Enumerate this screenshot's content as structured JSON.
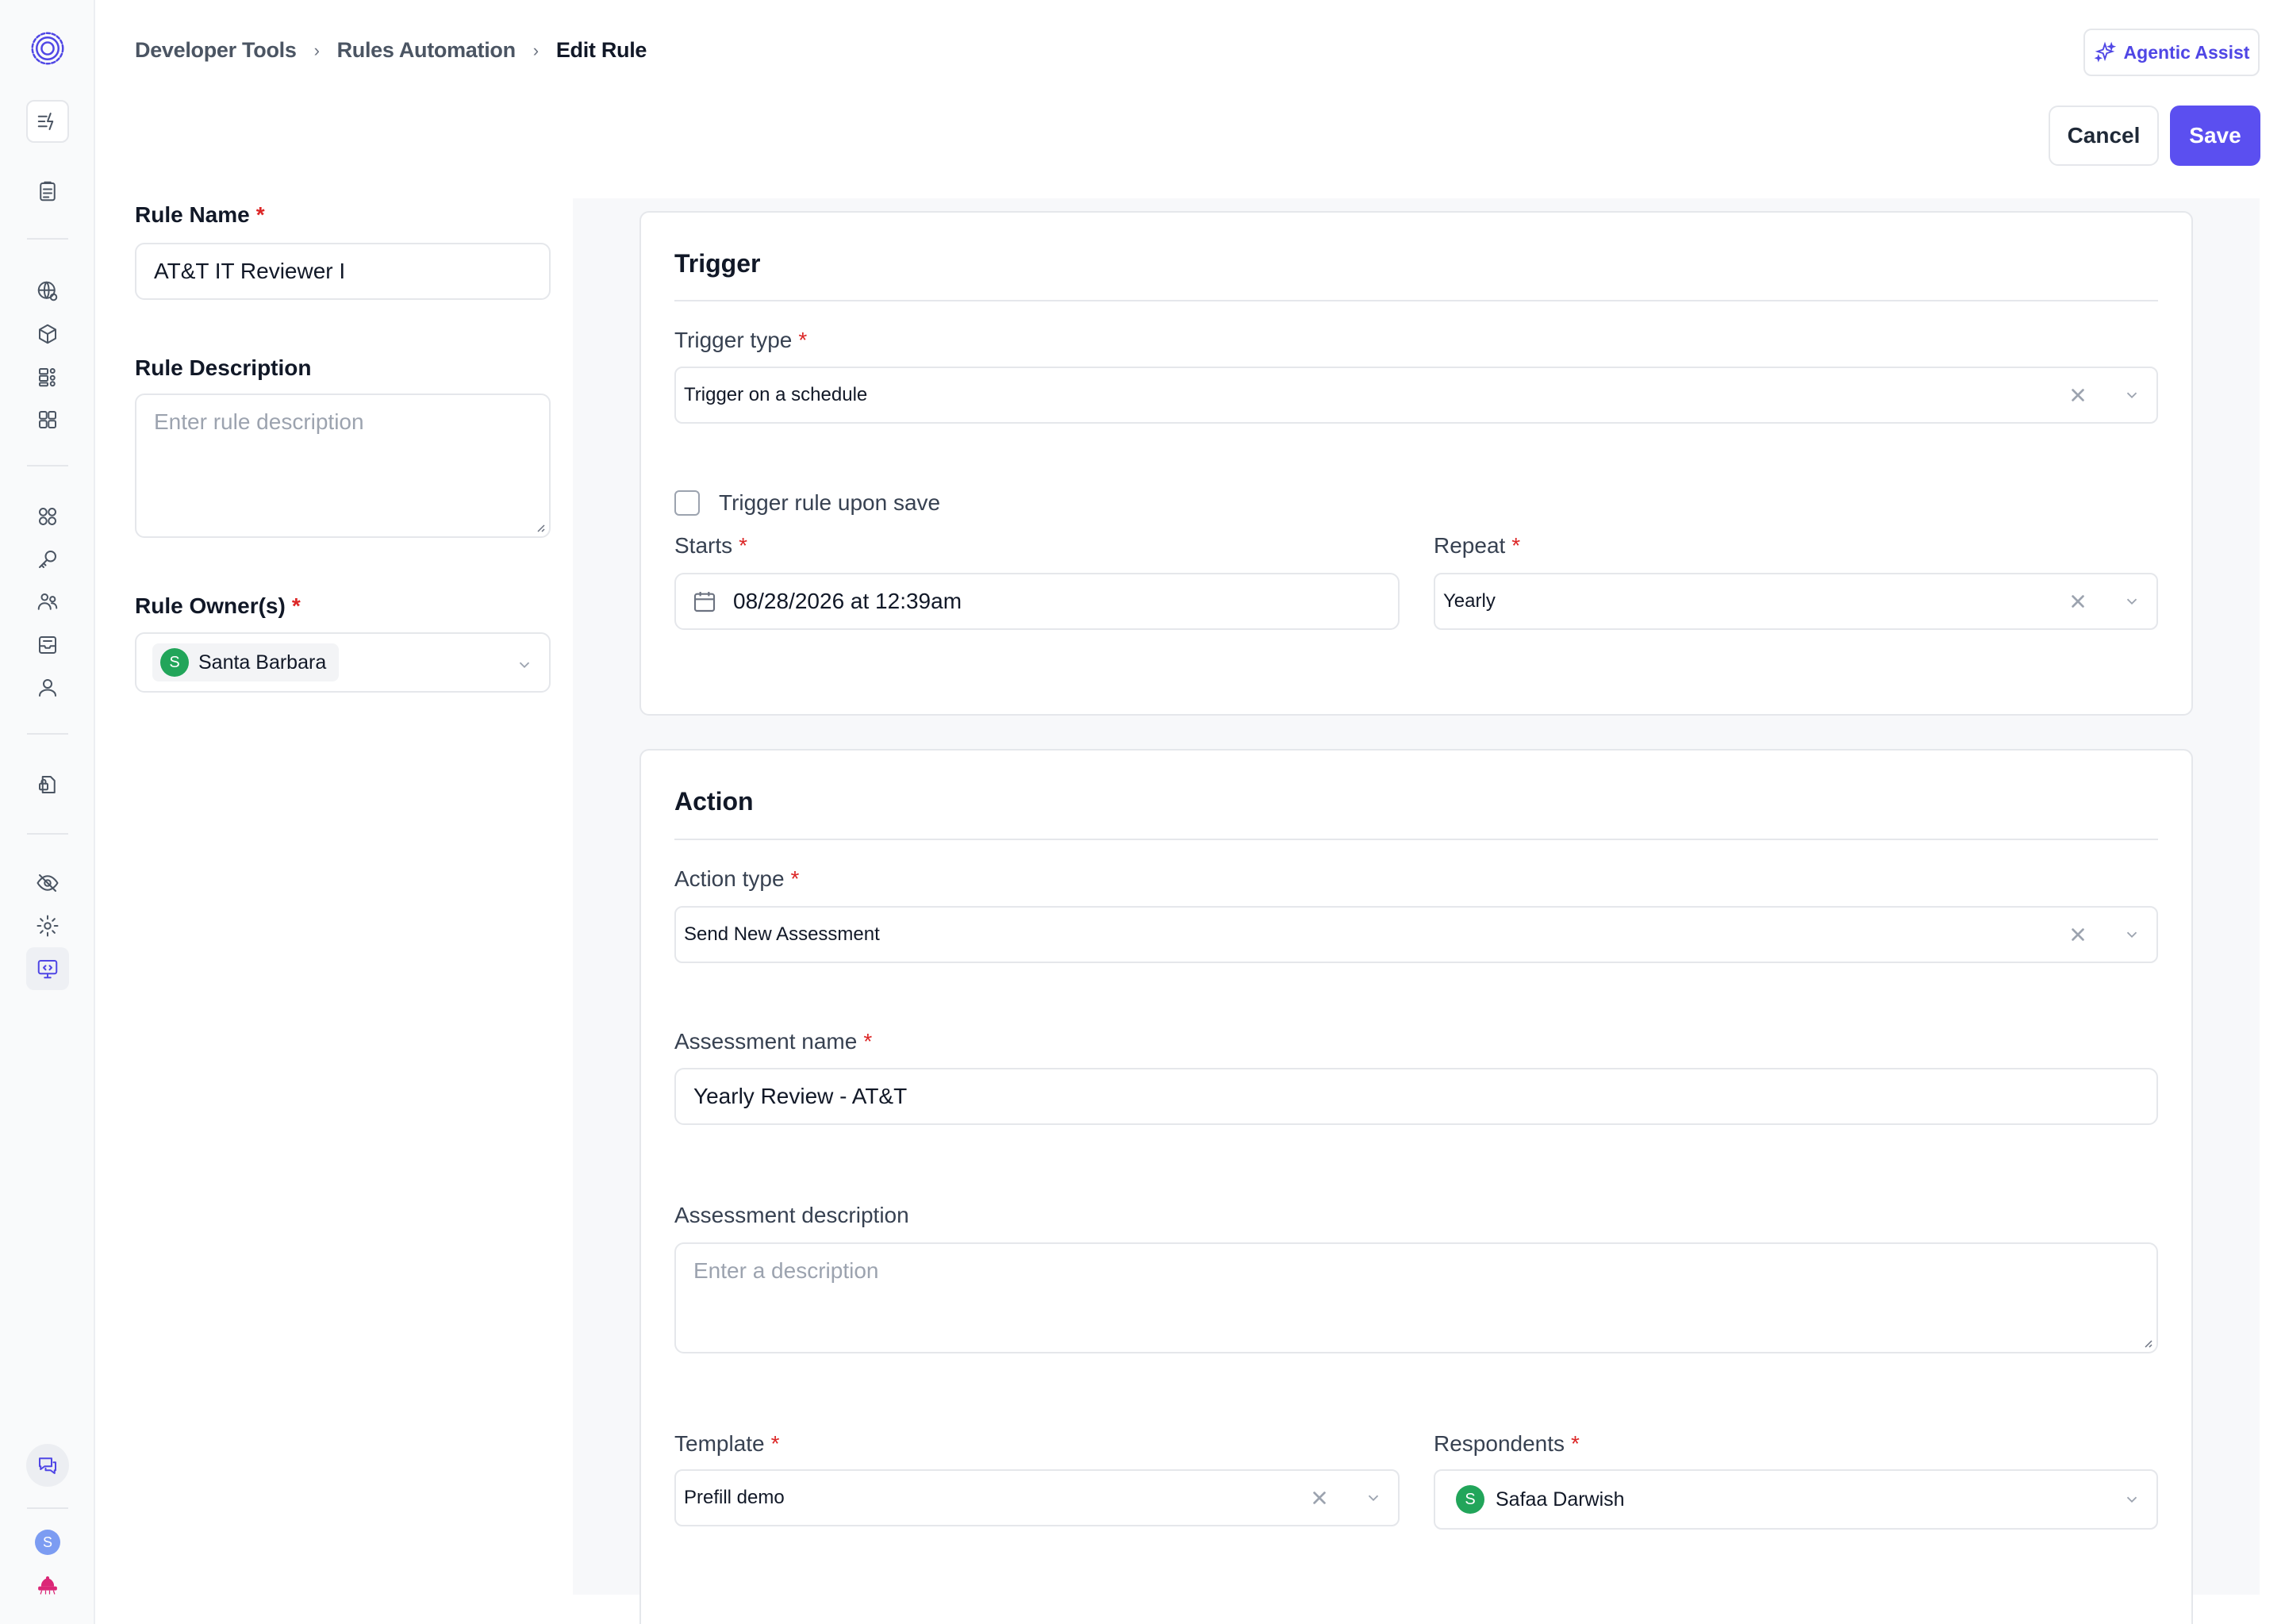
{
  "breadcrumb": {
    "items": [
      "Developer Tools",
      "Rules Automation",
      "Edit Rule"
    ]
  },
  "header": {
    "agentic_label": "Agentic Assist",
    "cancel_label": "Cancel",
    "save_label": "Save"
  },
  "rule": {
    "name_label": "Rule Name",
    "name_value": "AT&T IT Reviewer I",
    "description_label": "Rule Description",
    "description_placeholder": "Enter rule description",
    "owners_label": "Rule Owner(s)",
    "owner": {
      "initial": "S",
      "name": "Santa Barbara"
    }
  },
  "trigger": {
    "title": "Trigger",
    "type_label": "Trigger type",
    "type_value": "Trigger on a schedule",
    "upon_save_label": "Trigger rule upon save",
    "upon_save_checked": false,
    "starts_label": "Starts",
    "starts_value": "08/28/2026 at 12:39am",
    "repeat_label": "Repeat",
    "repeat_value": "Yearly"
  },
  "action": {
    "title": "Action",
    "type_label": "Action type",
    "type_value": "Send New Assessment",
    "assessment_name_label": "Assessment name",
    "assessment_name_value": "Yearly Review - AT&T",
    "assessment_description_label": "Assessment description",
    "assessment_description_placeholder": "Enter a description",
    "template_label": "Template",
    "template_value": "Prefill demo",
    "respondents_label": "Respondents",
    "respondent": {
      "initial": "S",
      "name": "Safaa Darwish"
    }
  },
  "sidebar": {
    "user_initial": "S"
  },
  "colors": {
    "accent": "#5b4ff0",
    "required": "#dc2626",
    "avatar_green": "#22a55a"
  }
}
